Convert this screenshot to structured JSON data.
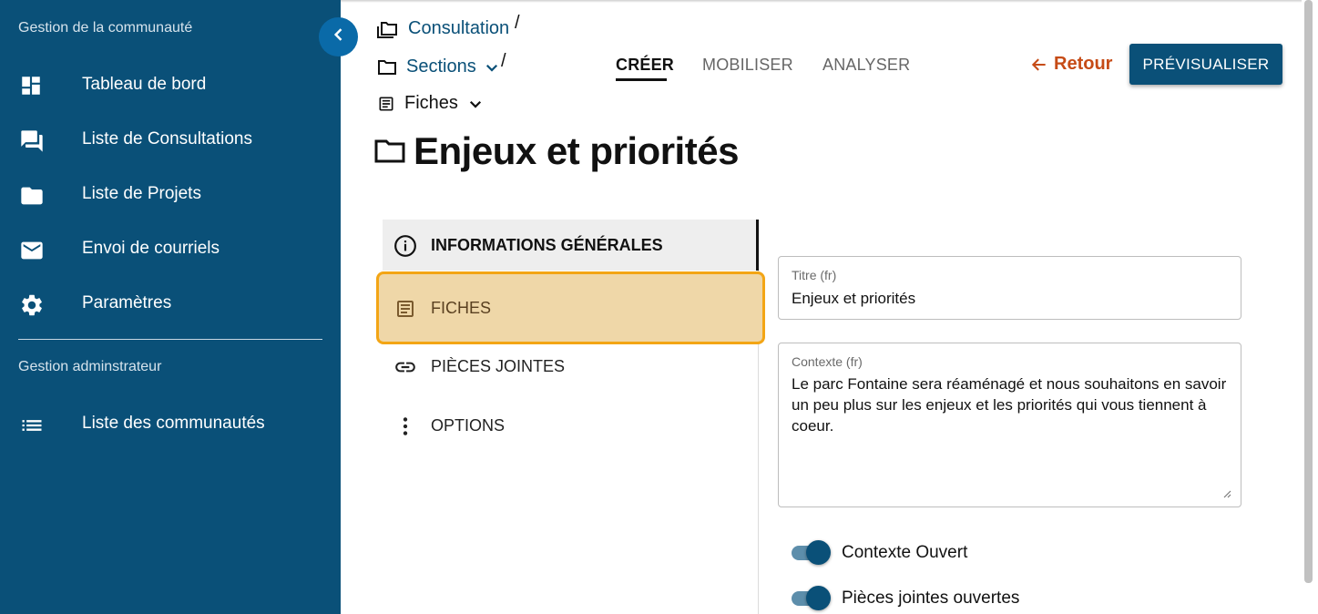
{
  "sidebar": {
    "section_community": "Gestion de la communauté",
    "section_admin": "Gestion adminstrateur",
    "items": [
      {
        "label": "Tableau de bord",
        "icon": "dashboard-icon"
      },
      {
        "label": "Liste de Consultations",
        "icon": "forum-icon"
      },
      {
        "label": "Liste de Projets",
        "icon": "folder-icon"
      },
      {
        "label": "Envoi de courriels",
        "icon": "mail-icon"
      },
      {
        "label": "Paramètres",
        "icon": "gear-icon"
      }
    ],
    "admin_items": [
      {
        "label": "Liste des communautés",
        "icon": "list-icon"
      }
    ]
  },
  "breadcrumb": {
    "consultation": "Consultation",
    "sections": "Sections",
    "fiches": "Fiches",
    "separator": "/"
  },
  "tabs": [
    {
      "label": "CRÉER",
      "active": true
    },
    {
      "label": "MOBILISER",
      "active": false
    },
    {
      "label": "ANALYSER",
      "active": false
    }
  ],
  "actions": {
    "back_label": "Retour",
    "preview_label": "PRÉVISUALISER"
  },
  "page": {
    "title": "Enjeux et priorités"
  },
  "section_nav": [
    {
      "label": "INFORMATIONS GÉNÉRALES",
      "icon": "info-icon",
      "state": "active"
    },
    {
      "label": "FICHES",
      "icon": "article-icon",
      "state": "focused"
    },
    {
      "label": "PIÈCES JOINTES",
      "icon": "link-icon",
      "state": "normal"
    },
    {
      "label": "OPTIONS",
      "icon": "more-vertical-icon",
      "state": "normal"
    }
  ],
  "form": {
    "title_label": "Titre (fr)",
    "title_value": "Enjeux et priorités",
    "context_label": "Contexte (fr)",
    "context_value": "Le parc Fontaine sera réaménagé et nous souhaitons en savoir un peu plus sur les enjeux et les priorités qui vous tiennent à coeur.",
    "toggles": [
      {
        "label": "Contexte Ouvert",
        "on": true
      },
      {
        "label": "Pièces jointes ouvertes",
        "on": true
      }
    ]
  },
  "colors": {
    "sidebar_bg": "#0a5078",
    "primary": "#0a5078",
    "accent_back": "#c64b16",
    "focus_border": "#f3a515",
    "focus_bg": "#efd7a8"
  }
}
